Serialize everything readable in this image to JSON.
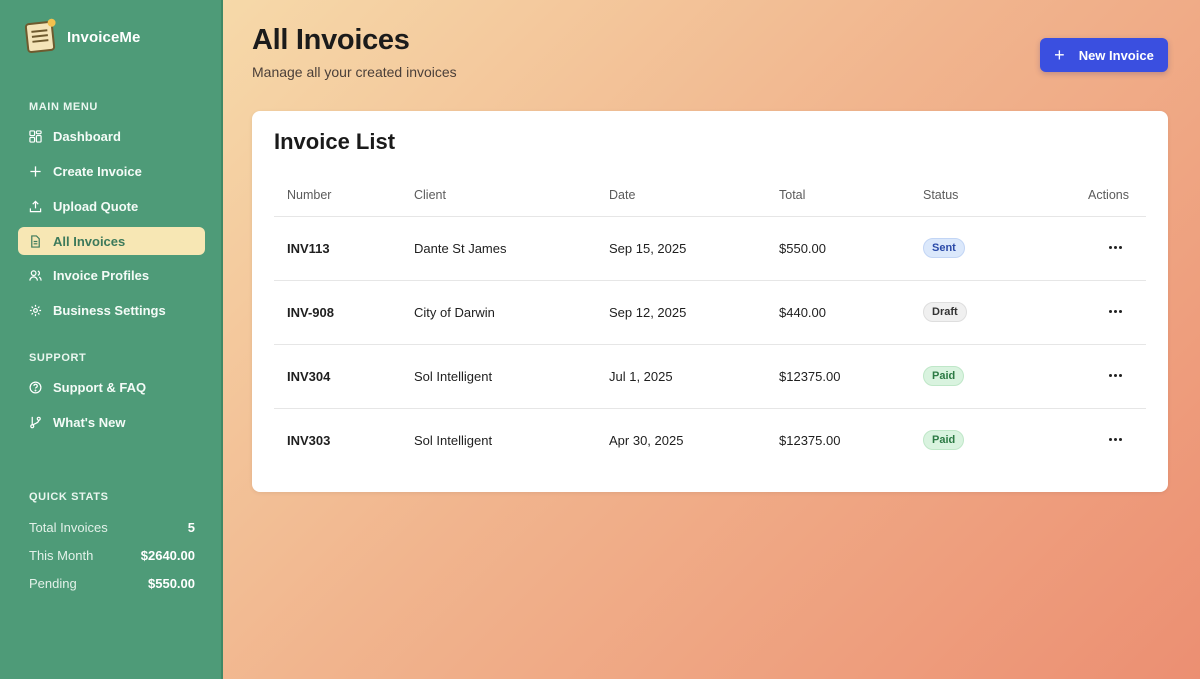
{
  "brand": {
    "name": "InvoiceMe"
  },
  "sidebar": {
    "main_menu_title": "MAIN MENU",
    "main_menu": [
      {
        "label": "Dashboard",
        "icon": "dashboard-icon"
      },
      {
        "label": "Create Invoice",
        "icon": "plus-icon"
      },
      {
        "label": "Upload Quote",
        "icon": "upload-icon"
      },
      {
        "label": "All Invoices",
        "icon": "document-icon",
        "active": true
      },
      {
        "label": "Invoice Profiles",
        "icon": "users-icon"
      },
      {
        "label": "Business Settings",
        "icon": "gear-icon"
      }
    ],
    "support_title": "SUPPORT",
    "support": [
      {
        "label": "Support & FAQ",
        "icon": "help-circle-icon"
      },
      {
        "label": "What's New",
        "icon": "git-branch-icon"
      }
    ],
    "quick_stats_title": "QUICK STATS",
    "quick_stats": [
      {
        "label": "Total Invoices",
        "value": "5"
      },
      {
        "label": "This Month",
        "value": "$2640.00"
      },
      {
        "label": "Pending",
        "value": "$550.00"
      }
    ]
  },
  "header": {
    "title": "All Invoices",
    "subtitle": "Manage all your created invoices",
    "new_button_label": "New Invoice"
  },
  "invoice_list": {
    "title": "Invoice List",
    "columns": [
      "Number",
      "Client",
      "Date",
      "Total",
      "Status",
      "Actions"
    ],
    "rows": [
      {
        "number": "INV113",
        "client": "Dante St James",
        "date": "Sep 15, 2025",
        "total": "$550.00",
        "status": "Sent"
      },
      {
        "number": "INV-908",
        "client": "City of Darwin",
        "date": "Sep 12, 2025",
        "total": "$440.00",
        "status": "Draft"
      },
      {
        "number": "INV304",
        "client": "Sol Intelligent",
        "date": "Jul 1, 2025",
        "total": "$12375.00",
        "status": "Paid"
      },
      {
        "number": "INV303",
        "client": "Sol Intelligent",
        "date": "Apr 30, 2025",
        "total": "$12375.00",
        "status": "Paid"
      }
    ]
  },
  "colors": {
    "sidebar": "#4e9b78",
    "active_nav": "#f7e7b4",
    "primary_button": "#3a4fe0",
    "status_sent": "#dbe8fb",
    "status_draft": "#f0f0f0",
    "status_paid": "#d9f3df"
  }
}
